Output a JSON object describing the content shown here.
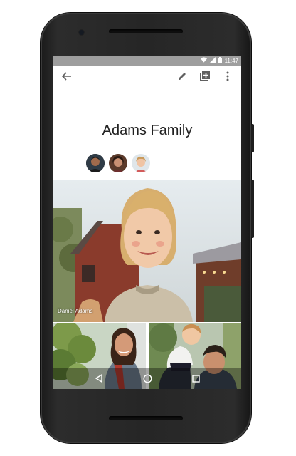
{
  "status_bar": {
    "time": "11:47",
    "icons": [
      "wifi-icon",
      "signal-icon",
      "battery-icon"
    ],
    "color": "#9e9e9e"
  },
  "app_bar": {
    "icons": [
      "back-arrow-icon",
      "edit-pencil-icon",
      "add-photo-icon",
      "more-vert-icon"
    ]
  },
  "album": {
    "title": "Adams Family",
    "shared_with": [
      "avatar-man",
      "avatar-woman",
      "avatar-child"
    ]
  },
  "photos": [
    {
      "caption": "Daniel Adams"
    }
  ],
  "nav_bar": {
    "icons": [
      "back-triangle-icon",
      "home-circle-icon",
      "recents-square-icon"
    ]
  }
}
